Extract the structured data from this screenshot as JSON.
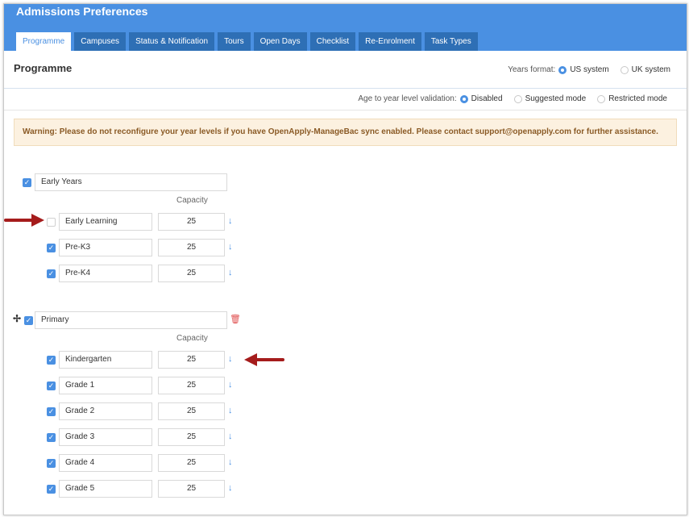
{
  "header": {
    "title": "Admissions Preferences"
  },
  "tabs": [
    "Programme",
    "Campuses",
    "Status & Notification",
    "Tours",
    "Open Days",
    "Checklist",
    "Re-Enrolment",
    "Task Types"
  ],
  "page": {
    "title": "Programme"
  },
  "years_format": {
    "label": "Years format:",
    "options": [
      "US system",
      "UK system"
    ],
    "selected": "US system"
  },
  "age_validation": {
    "label": "Age to year level validation:",
    "options": [
      "Disabled",
      "Suggested mode",
      "Restricted mode"
    ],
    "selected": "Disabled"
  },
  "warning": "Warning: Please do not reconfigure your year levels if you have OpenApply-ManageBac sync enabled. Please contact support@openapply.com for further assistance.",
  "capacity_label": "Capacity",
  "groups": [
    {
      "name": "Early Years",
      "checked": true,
      "levels": [
        {
          "name": "Early Learning",
          "checked": false,
          "capacity": "25"
        },
        {
          "name": "Pre-K3",
          "checked": true,
          "capacity": "25"
        },
        {
          "name": "Pre-K4",
          "checked": true,
          "capacity": "25"
        }
      ]
    },
    {
      "name": "Primary",
      "checked": true,
      "levels": [
        {
          "name": "Kindergarten",
          "checked": true,
          "capacity": "25"
        },
        {
          "name": "Grade 1",
          "checked": true,
          "capacity": "25"
        },
        {
          "name": "Grade 2",
          "checked": true,
          "capacity": "25"
        },
        {
          "name": "Grade 3",
          "checked": true,
          "capacity": "25"
        },
        {
          "name": "Grade 4",
          "checked": true,
          "capacity": "25"
        },
        {
          "name": "Grade 5",
          "checked": true,
          "capacity": "25"
        }
      ]
    }
  ],
  "colors": {
    "accent": "#4a90e2",
    "tab_bg": "#2e6fb5",
    "warning_bg": "#fcf1e0",
    "warning_text": "#8a5a25",
    "callout": "#a51c1c",
    "delete": "#e05050"
  }
}
